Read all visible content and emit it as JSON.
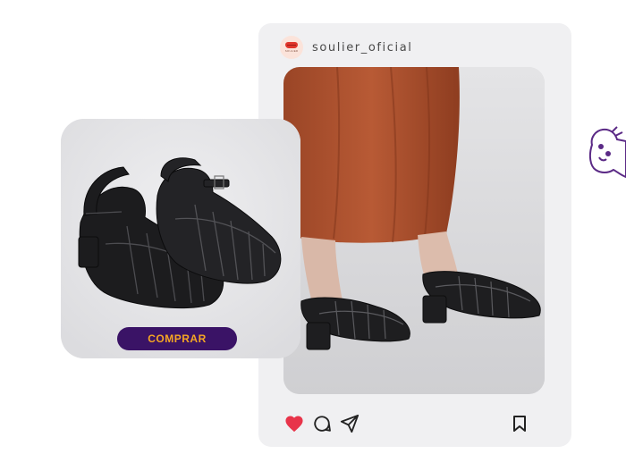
{
  "post": {
    "username": "soulier_oficial",
    "avatar_brand": "SOULIER",
    "icons": {
      "like": "heart-icon",
      "comment": "comment-icon",
      "share": "send-icon",
      "save": "bookmark-icon"
    },
    "like_color": "#e8344a"
  },
  "product": {
    "buy_label": "COMPRAR",
    "button_color": "#3a1366",
    "button_text_color": "#f5a623"
  },
  "decoration": {
    "icon": "ghost-icon",
    "color": "#5b2a86"
  }
}
